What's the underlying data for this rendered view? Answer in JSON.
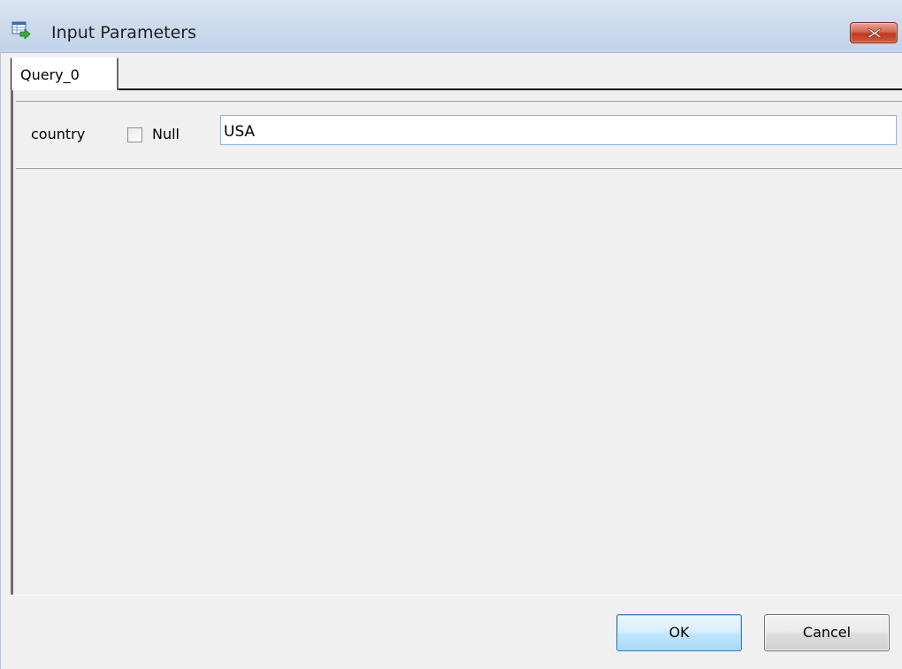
{
  "window": {
    "title": "Input Parameters",
    "icon": "table-arrow-icon",
    "close_icon": "close-icon",
    "close_color": "#c7432a"
  },
  "tabs": [
    {
      "label": "Query_0",
      "selected": true
    }
  ],
  "parameters": [
    {
      "name": "country",
      "null_label": "Null",
      "null_checked": false,
      "value": "USA"
    }
  ],
  "buttons": {
    "ok_label": "OK",
    "cancel_label": "Cancel"
  },
  "colors": {
    "titlebar": "#cddbed",
    "input_focus_border": "#7eb4ea",
    "default_button_border": "#3c7fb1",
    "background": "#f0f0f0"
  }
}
